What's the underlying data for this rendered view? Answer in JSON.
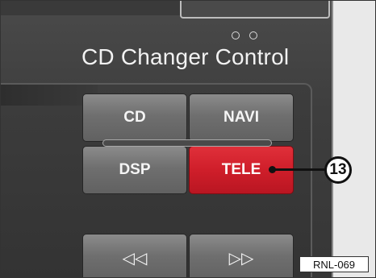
{
  "header": {
    "title": "CD Changer Control"
  },
  "buttons": {
    "cd": "CD",
    "navi": "NAVI",
    "dsp": "DSP",
    "tele": "TELE",
    "rewind": "◁◁",
    "fast_forward": "▷▷"
  },
  "callout": {
    "number": "13"
  },
  "reference": {
    "code": "RNL-069"
  },
  "colors": {
    "active_button": "#cf1e2a",
    "panel": "#3e3e3e"
  }
}
